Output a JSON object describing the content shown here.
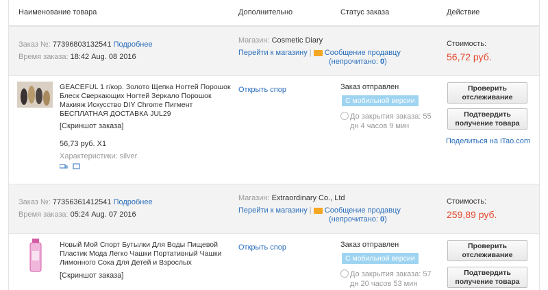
{
  "header": {
    "col_product": "Наименование товара",
    "col_extra": "Дополнительно",
    "col_status": "Статус заказа",
    "col_action": "Действие"
  },
  "orders": [
    {
      "order_label": "Заказ №:",
      "order_number": "77396803132541",
      "details_link": "Подробнее",
      "time_label": "Время заказа:",
      "time_value": "18:42 Aug. 08 2016",
      "shop_label": "Магазин:",
      "shop_name": "Cosmetic Diary",
      "goto_shop": "Перейти к магазину",
      "separator": "|",
      "message_seller": "Сообщение продавцу",
      "unread_open": "(непрочитано:",
      "unread_count": "0",
      "unread_close": ")",
      "cost_label": "Стоимость:",
      "cost_value": "56,72 руб.",
      "product_title": "GEACEFUL 1 г/кор. Золото Щепка Ногтей Порошок Блеск Сверкающих Ногтей Зеркало Порошок Макияж Искусство DIY Chrome Пигмент БЕСПЛАТНАЯ ДОСТАВКА JUL29",
      "screenshot": "[Скриншот заказа]",
      "price_qty": "56,73 руб. X1",
      "characteristics": "Характеристики: silver",
      "dispute": "Открыть спор",
      "status": "Заказ отправлен",
      "mobile_badge": "С мобильной версии",
      "closing_line1": "До закрытия заказа: 55",
      "closing_line2": "дн 4 часов 9 мин",
      "btn_track": "Проверить отслеживание",
      "btn_confirm": "Подтвердить получение товара",
      "share_prefix": "Поделиться на",
      "share_site": "iTao.com"
    },
    {
      "order_label": "Заказ №:",
      "order_number": "77356361412541",
      "details_link": "Подробнее",
      "time_label": "Время заказа:",
      "time_value": "05:24 Aug. 07 2016",
      "shop_label": "Магазин:",
      "shop_name": "Extraordinary Co., Ltd",
      "goto_shop": "Перейти к магазину",
      "separator": "|",
      "message_seller": "Сообщение продавцу",
      "unread_open": "(непрочитано:",
      "unread_count": "0",
      "unread_close": ")",
      "cost_label": "Стоимость:",
      "cost_value": "259,89 руб.",
      "product_title": "Новый Мой Спорт Бутылки Для Воды Пищевой Пластик Мода Легко Чашки Портативный Чашки Лимонного Сока Для Детей и Взрослых",
      "screenshot": "[Скриншот заказа]",
      "dispute": "Открыть спор",
      "status": "Заказ отправлен",
      "mobile_badge": "С мобильной версии",
      "closing_line1": "До закрытия заказа: 57",
      "closing_line2": "дн 20 часов 53 мин",
      "btn_track": "Проверить отслеживание",
      "btn_confirm": "Подтвердить получение товара"
    }
  ],
  "colors": {
    "link": "#2a6ebb",
    "price": "#e4462c",
    "badge": "#9fd4f1",
    "header_bg": "#f3f3f3"
  }
}
